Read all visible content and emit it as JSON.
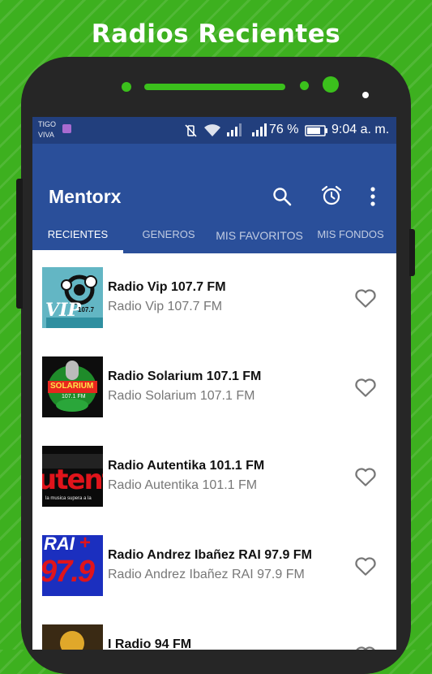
{
  "headline": "Radios Recientes",
  "status_bar": {
    "carrier_line1": "TIGO",
    "carrier_line2": "VIVA",
    "battery_percent": "76 %",
    "time": "9:04 a. m."
  },
  "app_bar": {
    "title": "Mentorx",
    "icons": [
      "search-icon",
      "alarm-clock-icon",
      "more-vert-icon"
    ]
  },
  "tabs": [
    {
      "label": "RECIENTES",
      "active": true
    },
    {
      "label": "GENEROS",
      "active": false
    },
    {
      "label": "MIS FAVORITOS",
      "active": false
    },
    {
      "label": "MIS FONDOS",
      "active": false
    }
  ],
  "stations": [
    {
      "name": "Radio Vip 107.7 FM",
      "subtitle": "Radio Vip 107.7 FM",
      "logo_text": "VIP",
      "logo_sub": "107.7"
    },
    {
      "name": "Radio Solarium 107.1 FM",
      "subtitle": "Radio Solarium 107.1 FM",
      "logo_text": "SOLARIUM",
      "logo_sub": "107.1 FM"
    },
    {
      "name": "Radio Autentika 101.1 FM",
      "subtitle": "Radio Autentika 101.1 FM",
      "logo_text": "utentic",
      "logo_sub": "la musica supera a la"
    },
    {
      "name": "Radio Andrez Ibañez RAI 97.9 FM",
      "subtitle": "Radio Andrez Ibañez RAI 97.9 FM",
      "logo_text": "97.9",
      "logo_sub": "RAI"
    },
    {
      "name": "I Radio 94 FM",
      "subtitle": "",
      "logo_text": "",
      "logo_sub": ""
    }
  ]
}
